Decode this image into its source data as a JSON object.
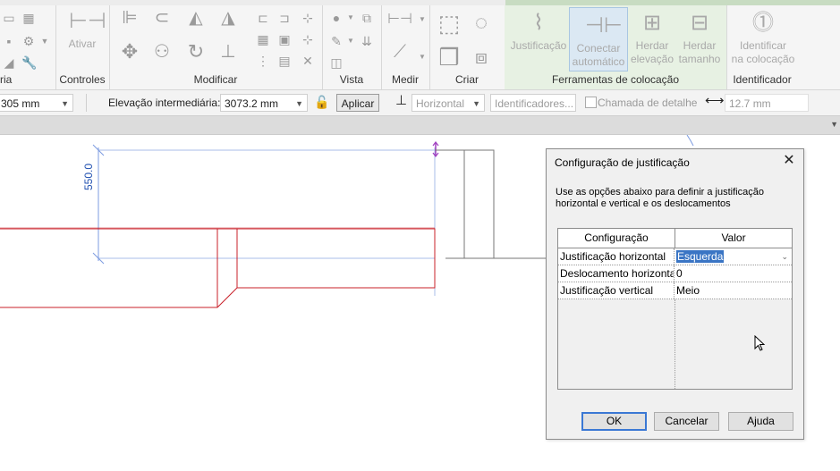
{
  "ribbon": {
    "groups": [
      {
        "label": "ria"
      },
      {
        "label": "Controles"
      },
      {
        "label": "Modificar"
      },
      {
        "label": "Vista"
      },
      {
        "label": "Medir"
      },
      {
        "label": "Criar"
      },
      {
        "label": "Ferramentas de colocação"
      },
      {
        "label": "Identificador"
      }
    ],
    "buttons": {
      "ativar": "Ativar",
      "justificacao": "Justificação",
      "conectar_line1": "Conectar",
      "conectar_line2": "automático",
      "herdar_elev_line1": "Herdar",
      "herdar_elev_line2": "elevação",
      "herdar_tam_line1": "Herdar",
      "herdar_tam_line2": "tamanho",
      "identificar_line1": "Identificar",
      "identificar_line2": "na colocação"
    }
  },
  "options_bar": {
    "size_value": "305 mm",
    "elevation_label": "Elevação intermediária:",
    "elevation_value": "3073.2 mm",
    "apply_label": "Aplicar",
    "horizontal_value": "Horizontal",
    "identifiers_label": "Identificadores...",
    "detail_callout_label": "Chamada de detalhe",
    "distance_value": "12.7 mm"
  },
  "canvas": {
    "dimension_text": "550.0"
  },
  "dialog": {
    "title": "Configuração de justificação",
    "description": "Use as opções abaixo para definir a justificação horizontal e vertical e os deslocamentos",
    "columns": [
      "Configuração",
      "Valor"
    ],
    "rows": [
      {
        "setting": "Justificação horizontal",
        "value": "Esquerda"
      },
      {
        "setting": "Deslocamento horizontal",
        "value": "0"
      },
      {
        "setting": "Justificação vertical",
        "value": "Meio"
      }
    ],
    "buttons": {
      "ok": "OK",
      "cancel": "Cancelar",
      "help": "Ajuda"
    }
  },
  "colors": {
    "selection_blue": "#3a75c4",
    "dimension_blue": "#1f4fb0",
    "wall_red": "#c8202a",
    "ribbon_green": "#e7f1e3"
  }
}
